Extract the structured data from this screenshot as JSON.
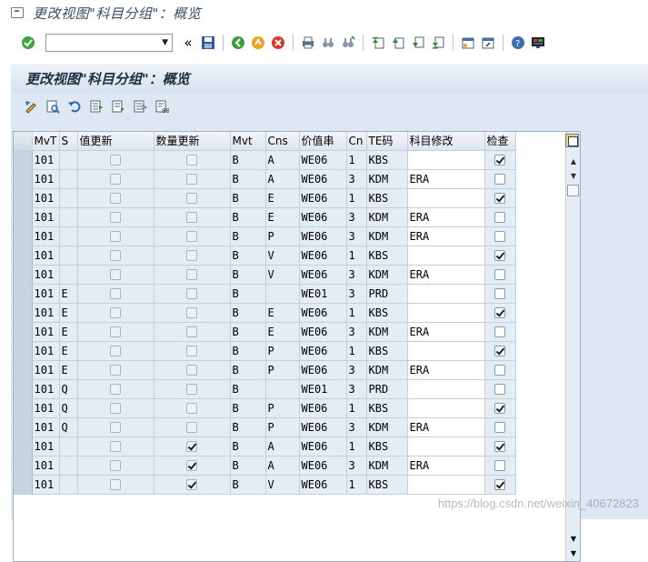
{
  "window_title": "更改视图\"科目分组\"：概览",
  "screen_title": "更改视图\"科目分组\"：概览",
  "command_field": {
    "value": ""
  },
  "toolbar": {
    "back_label": "«"
  },
  "columns": [
    "MvT",
    "S",
    "值更新",
    "数量更新",
    "Mvt",
    "Cns",
    "价值串",
    "Cn",
    "TE码",
    "科目修改",
    "检查"
  ],
  "rows": [
    {
      "mvt": "101",
      "s": "",
      "val": false,
      "qty": false,
      "mvt2": "B",
      "cns": "A",
      "vs": "WE06",
      "cn": "1",
      "te": "KBS",
      "acct": "",
      "chk": true
    },
    {
      "mvt": "101",
      "s": "",
      "val": false,
      "qty": false,
      "mvt2": "B",
      "cns": "A",
      "vs": "WE06",
      "cn": "3",
      "te": "KDM",
      "acct": "ERA",
      "chk": false
    },
    {
      "mvt": "101",
      "s": "",
      "val": false,
      "qty": false,
      "mvt2": "B",
      "cns": "E",
      "vs": "WE06",
      "cn": "1",
      "te": "KBS",
      "acct": "",
      "chk": true
    },
    {
      "mvt": "101",
      "s": "",
      "val": false,
      "qty": false,
      "mvt2": "B",
      "cns": "E",
      "vs": "WE06",
      "cn": "3",
      "te": "KDM",
      "acct": "ERA",
      "chk": false
    },
    {
      "mvt": "101",
      "s": "",
      "val": false,
      "qty": false,
      "mvt2": "B",
      "cns": "P",
      "vs": "WE06",
      "cn": "3",
      "te": "KDM",
      "acct": "ERA",
      "chk": false
    },
    {
      "mvt": "101",
      "s": "",
      "val": false,
      "qty": false,
      "mvt2": "B",
      "cns": "V",
      "vs": "WE06",
      "cn": "1",
      "te": "KBS",
      "acct": "",
      "chk": true
    },
    {
      "mvt": "101",
      "s": "",
      "val": false,
      "qty": false,
      "mvt2": "B",
      "cns": "V",
      "vs": "WE06",
      "cn": "3",
      "te": "KDM",
      "acct": "ERA",
      "chk": false
    },
    {
      "mvt": "101",
      "s": "E",
      "val": false,
      "qty": false,
      "mvt2": "B",
      "cns": "",
      "vs": "WE01",
      "cn": "3",
      "te": "PRD",
      "acct": "",
      "chk": false
    },
    {
      "mvt": "101",
      "s": "E",
      "val": false,
      "qty": false,
      "mvt2": "B",
      "cns": "E",
      "vs": "WE06",
      "cn": "1",
      "te": "KBS",
      "acct": "",
      "chk": true
    },
    {
      "mvt": "101",
      "s": "E",
      "val": false,
      "qty": false,
      "mvt2": "B",
      "cns": "E",
      "vs": "WE06",
      "cn": "3",
      "te": "KDM",
      "acct": "ERA",
      "chk": false
    },
    {
      "mvt": "101",
      "s": "E",
      "val": false,
      "qty": false,
      "mvt2": "B",
      "cns": "P",
      "vs": "WE06",
      "cn": "1",
      "te": "KBS",
      "acct": "",
      "chk": true
    },
    {
      "mvt": "101",
      "s": "E",
      "val": false,
      "qty": false,
      "mvt2": "B",
      "cns": "P",
      "vs": "WE06",
      "cn": "3",
      "te": "KDM",
      "acct": "ERA",
      "chk": false
    },
    {
      "mvt": "101",
      "s": "Q",
      "val": false,
      "qty": false,
      "mvt2": "B",
      "cns": "",
      "vs": "WE01",
      "cn": "3",
      "te": "PRD",
      "acct": "",
      "chk": false
    },
    {
      "mvt": "101",
      "s": "Q",
      "val": false,
      "qty": false,
      "mvt2": "B",
      "cns": "P",
      "vs": "WE06",
      "cn": "1",
      "te": "KBS",
      "acct": "",
      "chk": true
    },
    {
      "mvt": "101",
      "s": "Q",
      "val": false,
      "qty": false,
      "mvt2": "B",
      "cns": "P",
      "vs": "WE06",
      "cn": "3",
      "te": "KDM",
      "acct": "ERA",
      "chk": false
    },
    {
      "mvt": "101",
      "s": "",
      "val": false,
      "qty": true,
      "mvt2": "B",
      "cns": "A",
      "vs": "WE06",
      "cn": "1",
      "te": "KBS",
      "acct": "",
      "chk": true
    },
    {
      "mvt": "101",
      "s": "",
      "val": false,
      "qty": true,
      "mvt2": "B",
      "cns": "A",
      "vs": "WE06",
      "cn": "3",
      "te": "KDM",
      "acct": "ERA",
      "chk": false
    },
    {
      "mvt": "101",
      "s": "",
      "val": false,
      "qty": true,
      "mvt2": "B",
      "cns": "V",
      "vs": "WE06",
      "cn": "1",
      "te": "KBS",
      "acct": "",
      "chk": true
    }
  ],
  "watermark": "https://blog.csdn.net/weixin_40672823"
}
